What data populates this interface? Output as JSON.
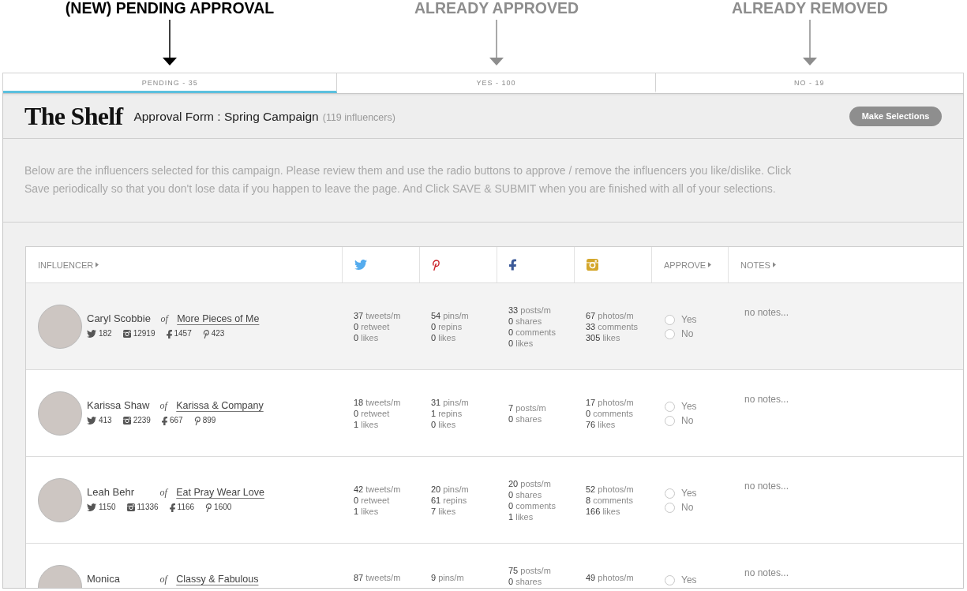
{
  "annotations": [
    {
      "label": "(NEW) PENDING APPROVAL",
      "highlighted": true
    },
    {
      "label": "ALREADY APPROVED",
      "highlighted": false
    },
    {
      "label": "ALREADY REMOVED",
      "highlighted": false
    }
  ],
  "tabs": [
    {
      "label": "PENDING - 35",
      "selected": true
    },
    {
      "label": "YES - 100",
      "selected": false
    },
    {
      "label": "NO - 19",
      "selected": false
    }
  ],
  "header": {
    "logo": "The Shelf",
    "title": "Approval Form : Spring Campaign",
    "count": "(119 influencers)",
    "button": "Make Selections"
  },
  "intro": "Below are the influencers selected for this campaign. Please review them and use the radio buttons to approve / remove the influencers you like/dislike. Click Save periodically so that you don't lose data if you happen to leave the page. And Click SAVE & SUBMIT when you are finished with all of your selections.",
  "table": {
    "columns": [
      {
        "kind": "label",
        "label": "INFLUENCER"
      },
      {
        "kind": "twitter"
      },
      {
        "kind": "pinterest"
      },
      {
        "kind": "facebook"
      },
      {
        "kind": "instagram"
      },
      {
        "kind": "label",
        "label": "APPROVE"
      },
      {
        "kind": "label",
        "label": "NOTES"
      }
    ],
    "rows": [
      {
        "kind": "full",
        "highlighted": true,
        "name": "Caryl Scobbie",
        "connector": "of",
        "blog": "More Pieces of Me",
        "socials": [
          {
            "kind": "twitter",
            "count": "182"
          },
          {
            "kind": "instagram",
            "count": "12919"
          },
          {
            "kind": "facebook",
            "count": "1457"
          },
          {
            "kind": "pinterest",
            "count": "423"
          }
        ],
        "stats": [
          [
            {
              "count": "37",
              "unit": "tweets/m"
            },
            {
              "count": "0",
              "unit": "retweet"
            },
            {
              "count": "0",
              "unit": "likes"
            }
          ],
          [
            {
              "count": "54",
              "unit": "pins/m"
            },
            {
              "count": "0",
              "unit": "repins"
            },
            {
              "count": "0",
              "unit": "likes"
            }
          ],
          [
            {
              "count": "33",
              "unit": "posts/m"
            },
            {
              "count": "0",
              "unit": "shares"
            },
            {
              "count": "0",
              "unit": "comments"
            },
            {
              "count": "0",
              "unit": "likes"
            }
          ],
          [
            {
              "count": "67",
              "unit": "photos/m"
            },
            {
              "count": "33",
              "unit": "comments"
            },
            {
              "count": "305",
              "unit": "likes"
            }
          ]
        ],
        "approve": [
          {
            "label": "Yes",
            "selected": false
          },
          {
            "label": "No",
            "selected": false
          }
        ],
        "notes": "no notes..."
      },
      {
        "kind": "full",
        "highlighted": false,
        "name": "Karissa Shaw",
        "connector": "of",
        "blog": "Karissa & Company",
        "socials": [
          {
            "kind": "twitter",
            "count": "413"
          },
          {
            "kind": "instagram",
            "count": "2239"
          },
          {
            "kind": "facebook",
            "count": "667"
          },
          {
            "kind": "pinterest",
            "count": "899"
          }
        ],
        "stats": [
          [
            {
              "count": "18",
              "unit": "tweets/m"
            },
            {
              "count": "0",
              "unit": "retweet"
            },
            {
              "count": "1",
              "unit": "likes"
            }
          ],
          [
            {
              "count": "31",
              "unit": "pins/m"
            },
            {
              "count": "1",
              "unit": "repins"
            },
            {
              "count": "0",
              "unit": "likes"
            }
          ],
          [
            {
              "count": "7",
              "unit": "posts/m"
            },
            {
              "count": "0",
              "unit": "shares"
            }
          ],
          [
            {
              "count": "17",
              "unit": "photos/m"
            },
            {
              "count": "0",
              "unit": "comments"
            },
            {
              "count": "76",
              "unit": "likes"
            }
          ]
        ],
        "approve": [
          {
            "label": "Yes",
            "selected": false
          },
          {
            "label": "No",
            "selected": false
          }
        ],
        "notes": "no notes..."
      },
      {
        "kind": "full",
        "highlighted": false,
        "name": "Leah Behr",
        "connector": "of",
        "blog": "Eat Pray Wear Love",
        "socials": [
          {
            "kind": "twitter",
            "count": "1150"
          },
          {
            "kind": "instagram",
            "count": "11336"
          },
          {
            "kind": "facebook",
            "count": "1166"
          },
          {
            "kind": "pinterest",
            "count": "1600"
          }
        ],
        "stats": [
          [
            {
              "count": "42",
              "unit": "tweets/m"
            },
            {
              "count": "0",
              "unit": "retweet"
            },
            {
              "count": "1",
              "unit": "likes"
            }
          ],
          [
            {
              "count": "20",
              "unit": "pins/m"
            },
            {
              "count": "61",
              "unit": "repins"
            },
            {
              "count": "7",
              "unit": "likes"
            }
          ],
          [
            {
              "count": "20",
              "unit": "posts/m"
            },
            {
              "count": "0",
              "unit": "shares"
            },
            {
              "count": "0",
              "unit": "comments"
            },
            {
              "count": "1",
              "unit": "likes"
            }
          ],
          [
            {
              "count": "52",
              "unit": "photos/m"
            },
            {
              "count": "8",
              "unit": "comments"
            },
            {
              "count": "166",
              "unit": "likes"
            }
          ]
        ],
        "approve": [
          {
            "label": "Yes",
            "selected": false
          },
          {
            "label": "No",
            "selected": false
          }
        ],
        "notes": "no notes..."
      },
      {
        "kind": "partial",
        "highlighted": false,
        "name": "Monica",
        "connector": "of",
        "blog": "Classy & Fabulous",
        "stats": [
          [
            {
              "count": "87",
              "unit": "tweets/m"
            }
          ],
          [
            {
              "count": "9",
              "unit": "pins/m"
            }
          ],
          [
            {
              "count": "75",
              "unit": "posts/m"
            },
            {
              "count": "0",
              "unit": "shares"
            }
          ],
          [
            {
              "count": "49",
              "unit": "photos/m"
            }
          ]
        ],
        "approve": [
          {
            "label": "Yes",
            "selected": false
          }
        ],
        "notes": "no notes..."
      }
    ]
  }
}
